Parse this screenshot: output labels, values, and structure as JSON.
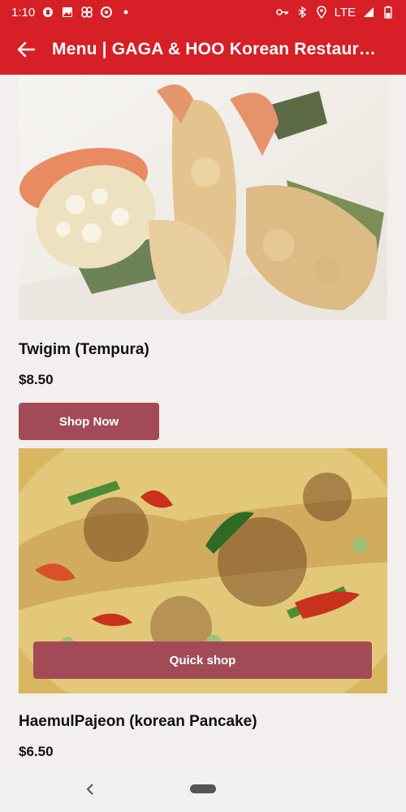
{
  "status_bar": {
    "time": "1:10",
    "network": "LTE"
  },
  "app_bar": {
    "title": "Menu | GAGA & HOO Korean Restaura…",
    "back_icon": "arrow-left-icon"
  },
  "items": [
    {
      "name": "Twigim (Tempura)",
      "price": "$8.50",
      "button_label": "Shop Now"
    },
    {
      "name": "HaemulPajeon (korean Pancake)",
      "price": "$6.50",
      "button_label": "Quick shop"
    }
  ],
  "colors": {
    "brand": "#d61f26",
    "button": "#a24b57",
    "background": "#f3efee"
  }
}
